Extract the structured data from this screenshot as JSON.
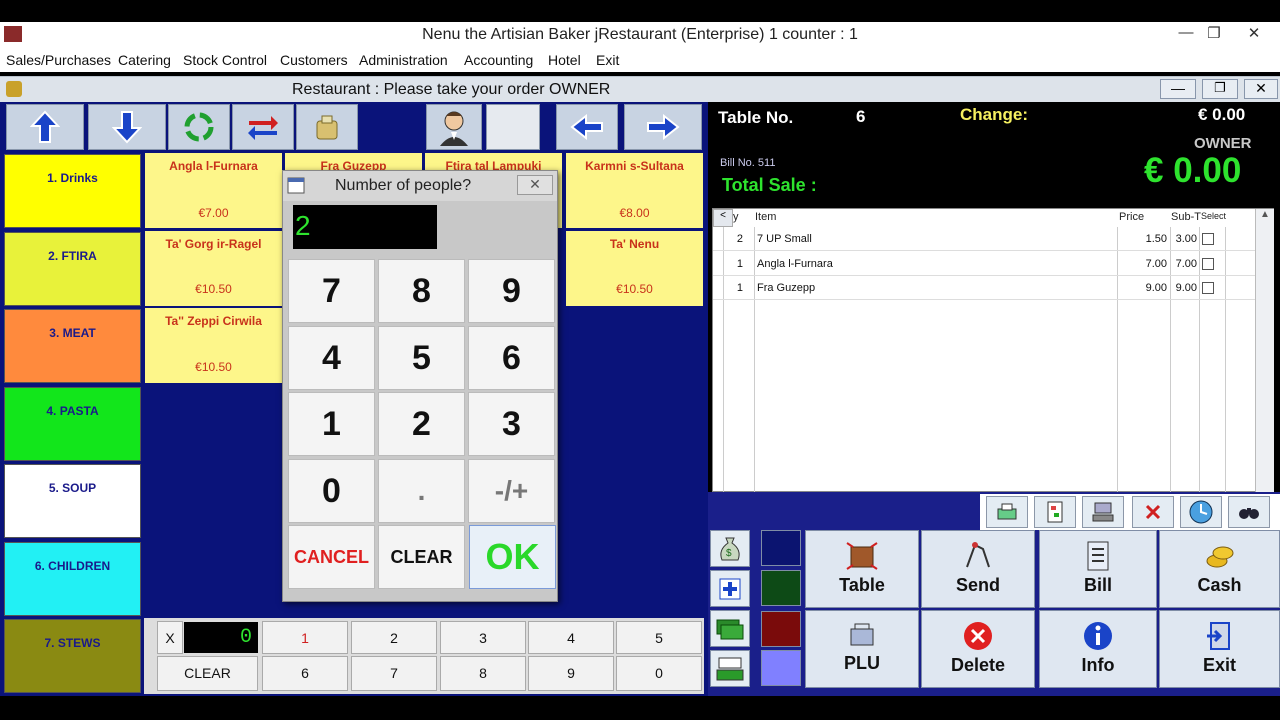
{
  "window": {
    "title": "Nenu the Artisian Baker jRestaurant (Enterprise) 1  counter : 1"
  },
  "menu": [
    "Sales/Purchases",
    "Catering",
    "Stock Control",
    "Customers",
    "Administration",
    "Accounting",
    "Hotel",
    "Exit"
  ],
  "subwindow": {
    "title": "Restaurant : Please take your order OWNER"
  },
  "categories": [
    {
      "label": "1. Drinks",
      "color": "#ffff00",
      "text": "#1a1a8a"
    },
    {
      "label": "2. FTIRA",
      "color": "#e8f23a",
      "text": "#1a1a8a"
    },
    {
      "label": "3. MEAT",
      "color": "#ff8a3d",
      "text": "#1a1a8a"
    },
    {
      "label": "4. PASTA",
      "color": "#12e61b",
      "text": "#1a1a8a"
    },
    {
      "label": "5. SOUP",
      "color": "#ffffff",
      "text": "#1a1a8a"
    },
    {
      "label": "6. CHILDREN",
      "color": "#22f0f4",
      "text": "#1a1a8a"
    },
    {
      "label": "7. STEWS",
      "color": "#8a8a12",
      "text": "#1a1a8a"
    }
  ],
  "items": [
    {
      "name": "Angla l-Furnara",
      "price": "€7.00"
    },
    {
      "name": "Fra Guzepp",
      "price": ""
    },
    {
      "name": "Ftira tal Lampuki",
      "price": ""
    },
    {
      "name": "Karmni s-Sultana",
      "price": "€8.00"
    },
    {
      "name": "Ta' Gorg ir-Ragel",
      "price": "€10.50"
    },
    {
      "name": "Ta' Nenu",
      "price": "€10.50"
    },
    {
      "name": "Ta'' Zeppi Cirwila",
      "price": "€10.50"
    }
  ],
  "qtypad": {
    "x_label": "X",
    "value": "0",
    "clear": "CLEAR",
    "keys_row1": [
      "1",
      "2",
      "3",
      "4",
      "5"
    ],
    "keys_row2": [
      "6",
      "7",
      "8",
      "9",
      "0"
    ]
  },
  "info": {
    "table_label": "Table No.",
    "table_value": "6",
    "change_label": "Change:",
    "change_value": "€ 0.00",
    "user": "OWNER",
    "bill_no": "Bill No. 511",
    "total_label": "Total Sale :",
    "total_value": "€ 0.00"
  },
  "grid": {
    "headers": {
      "qty": "y",
      "item": "Item",
      "price": "Price",
      "subtotal": "Sub-T",
      "select": "Select"
    },
    "rows": [
      {
        "qty": "2",
        "item": "7 UP Small",
        "price": "1.50",
        "subtotal": "3.00"
      },
      {
        "qty": "1",
        "item": "Angla l-Furnara",
        "price": "7.00",
        "subtotal": "7.00"
      },
      {
        "qty": "1",
        "item": "Fra Guzepp",
        "price": "9.00",
        "subtotal": "9.00"
      }
    ]
  },
  "actions": {
    "table": "Table",
    "send": "Send",
    "bill": "Bill",
    "cash": "Cash",
    "plu": "PLU",
    "delete": "Delete",
    "info": "Info",
    "exit": "Exit"
  },
  "swatches": [
    "#0b1470",
    "#0d4a16",
    "#7a0b0b",
    "#8080ff"
  ],
  "dialog": {
    "title": "Number of people?",
    "value": "2",
    "keys": [
      "7",
      "8",
      "9",
      "4",
      "5",
      "6",
      "1",
      "2",
      "3",
      "0",
      ".",
      "-/+"
    ],
    "cancel": "CANCEL",
    "clear": "CLEAR",
    "ok": "OK"
  }
}
